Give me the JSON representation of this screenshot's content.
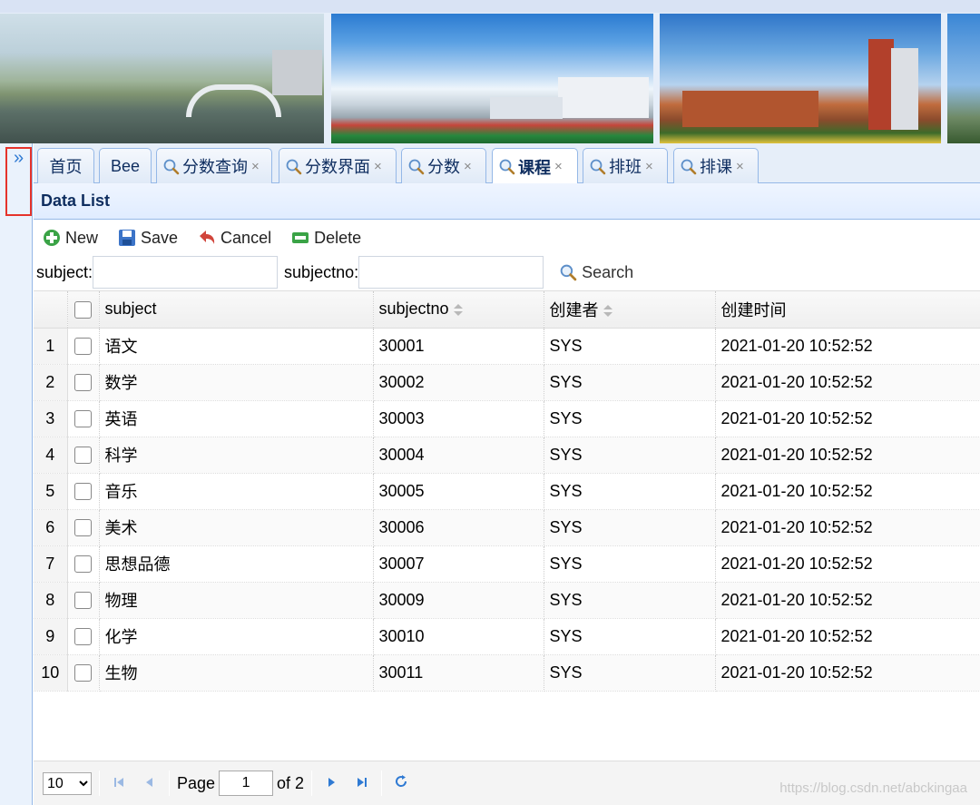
{
  "tabs": [
    {
      "label": "首页",
      "icon": "",
      "closable": false
    },
    {
      "label": "Bee",
      "icon": "",
      "closable": false
    },
    {
      "label": "分数查询",
      "icon": "search-icon",
      "closable": true
    },
    {
      "label": "分数界面",
      "icon": "search-icon",
      "closable": true
    },
    {
      "label": "分数",
      "icon": "search-icon",
      "closable": true
    },
    {
      "label": "课程",
      "icon": "search-icon",
      "closable": true,
      "active": true
    },
    {
      "label": "排班",
      "icon": "search-icon",
      "closable": true
    },
    {
      "label": "排课",
      "icon": "search-icon",
      "closable": true
    }
  ],
  "sidebar": {
    "expand_glyph": "»"
  },
  "tab_close_glyph": "×",
  "panel": {
    "title": "Data List"
  },
  "toolbar": {
    "new_label": "New",
    "save_label": "Save",
    "cancel_label": "Cancel",
    "delete_label": "Delete"
  },
  "search": {
    "subject_label": "subject:",
    "subject_value": "",
    "subjectno_label": "subjectno:",
    "subjectno_value": "",
    "button_label": "Search"
  },
  "grid": {
    "columns": [
      "subject",
      "subjectno",
      "创建者",
      "创建时间"
    ],
    "rows": [
      {
        "n": "1",
        "subject": "语文",
        "subjectno": "30001",
        "creator": "SYS",
        "time": "2021-01-20 10:52:52"
      },
      {
        "n": "2",
        "subject": "数学",
        "subjectno": "30002",
        "creator": "SYS",
        "time": "2021-01-20 10:52:52"
      },
      {
        "n": "3",
        "subject": "英语",
        "subjectno": "30003",
        "creator": "SYS",
        "time": "2021-01-20 10:52:52"
      },
      {
        "n": "4",
        "subject": "科学",
        "subjectno": "30004",
        "creator": "SYS",
        "time": "2021-01-20 10:52:52"
      },
      {
        "n": "5",
        "subject": "音乐",
        "subjectno": "30005",
        "creator": "SYS",
        "time": "2021-01-20 10:52:52"
      },
      {
        "n": "6",
        "subject": "美术",
        "subjectno": "30006",
        "creator": "SYS",
        "time": "2021-01-20 10:52:52"
      },
      {
        "n": "7",
        "subject": "思想品德",
        "subjectno": "30007",
        "creator": "SYS",
        "time": "2021-01-20 10:52:52"
      },
      {
        "n": "8",
        "subject": "物理",
        "subjectno": "30009",
        "creator": "SYS",
        "time": "2021-01-20 10:52:52"
      },
      {
        "n": "9",
        "subject": "化学",
        "subjectno": "30010",
        "creator": "SYS",
        "time": "2021-01-20 10:52:52"
      },
      {
        "n": "10",
        "subject": "生物",
        "subjectno": "30011",
        "creator": "SYS",
        "time": "2021-01-20 10:52:52"
      }
    ]
  },
  "pager": {
    "page_size_options": [
      "10"
    ],
    "page_size": "10",
    "page_label": "Page",
    "current_page": "1",
    "of_label": "of 2"
  },
  "watermark": "https://blog.csdn.net/abckingaa",
  "colors": {
    "accent": "#95b8e7",
    "title_text": "#0e2d5f",
    "nav_blue": "#2f7ad3",
    "highlight_border": "#e5332b"
  }
}
